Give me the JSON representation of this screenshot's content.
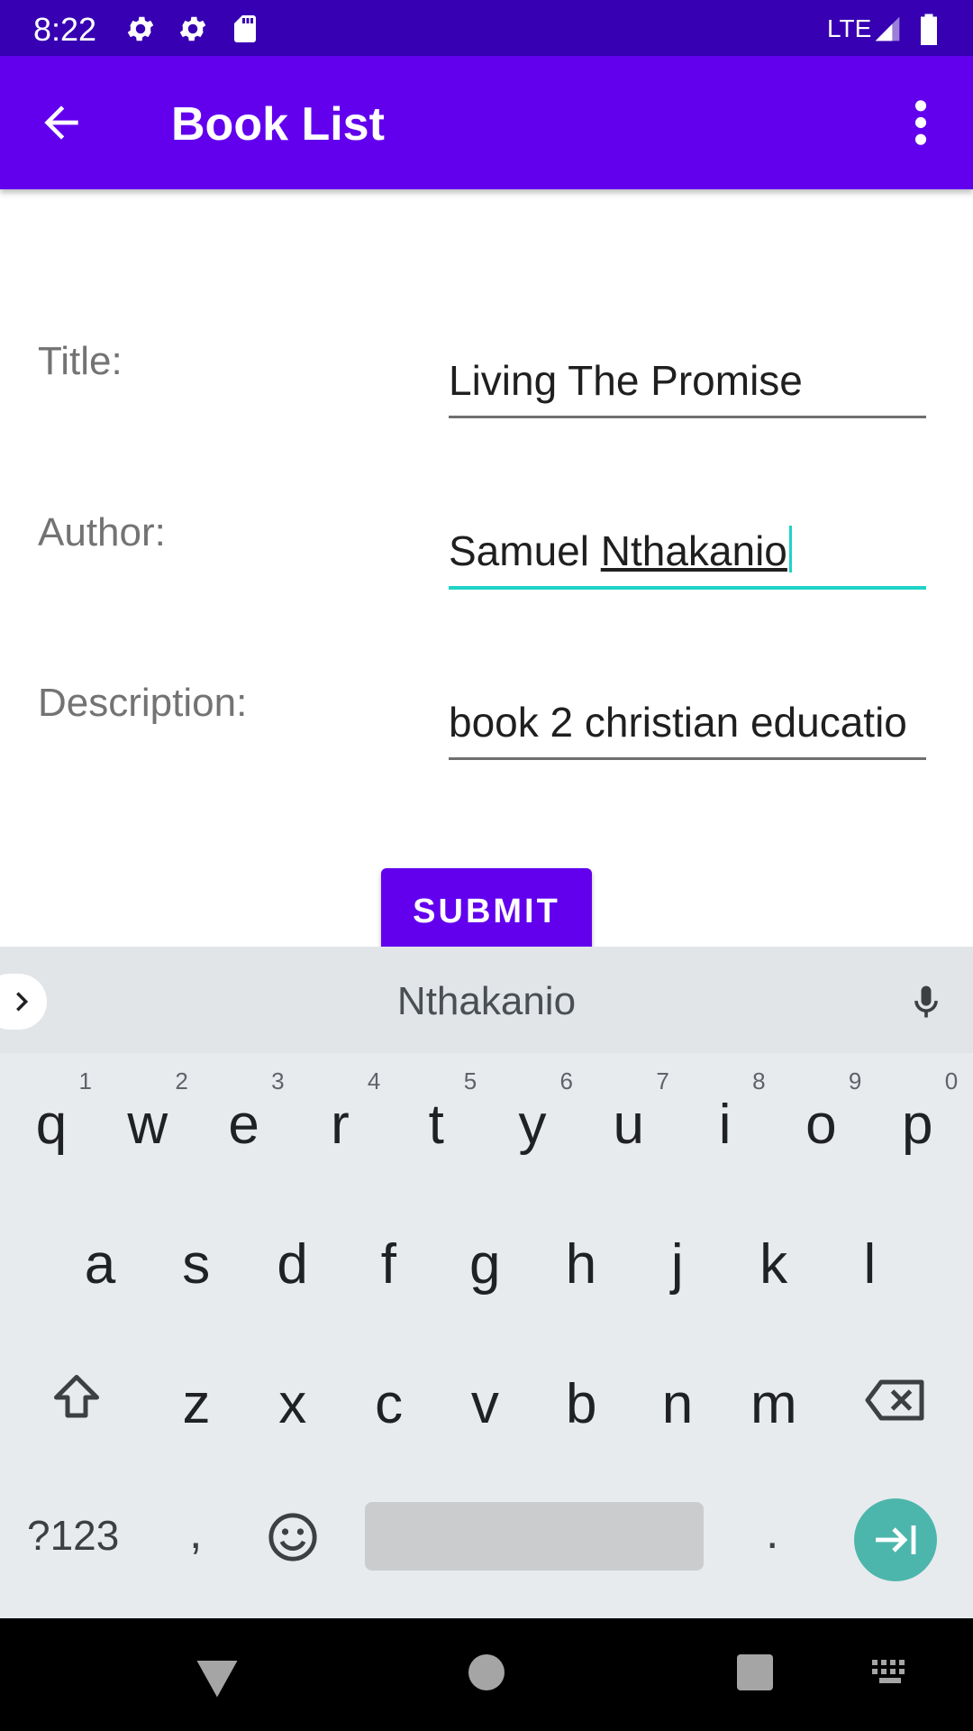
{
  "status_bar": {
    "time": "8:22",
    "network": "LTE"
  },
  "app_bar": {
    "title": "Book List"
  },
  "form": {
    "title_label": "Title:",
    "title_value": "Living The Promise",
    "author_label": "Author:",
    "author_value_first": "Samuel ",
    "author_value_composing": "Nthakanio",
    "description_label": "Description:",
    "description_value": "book  2 christian educatio",
    "submit_label": "SUBMIT"
  },
  "keyboard": {
    "suggestion": "Nthakanio",
    "row1": [
      {
        "letter": "q",
        "hint": "1"
      },
      {
        "letter": "w",
        "hint": "2"
      },
      {
        "letter": "e",
        "hint": "3"
      },
      {
        "letter": "r",
        "hint": "4"
      },
      {
        "letter": "t",
        "hint": "5"
      },
      {
        "letter": "y",
        "hint": "6"
      },
      {
        "letter": "u",
        "hint": "7"
      },
      {
        "letter": "i",
        "hint": "8"
      },
      {
        "letter": "o",
        "hint": "9"
      },
      {
        "letter": "p",
        "hint": "0"
      }
    ],
    "row2": [
      "a",
      "s",
      "d",
      "f",
      "g",
      "h",
      "j",
      "k",
      "l"
    ],
    "row3": [
      "z",
      "x",
      "c",
      "v",
      "b",
      "n",
      "m"
    ],
    "symbols_label": "?123",
    "comma_label": ",",
    "period_label": ".",
    "accent_color": "#4db6ac"
  },
  "colors": {
    "status_bar": "#3700b3",
    "primary": "#6200ee",
    "focus_underline": "#1fd3c6"
  }
}
